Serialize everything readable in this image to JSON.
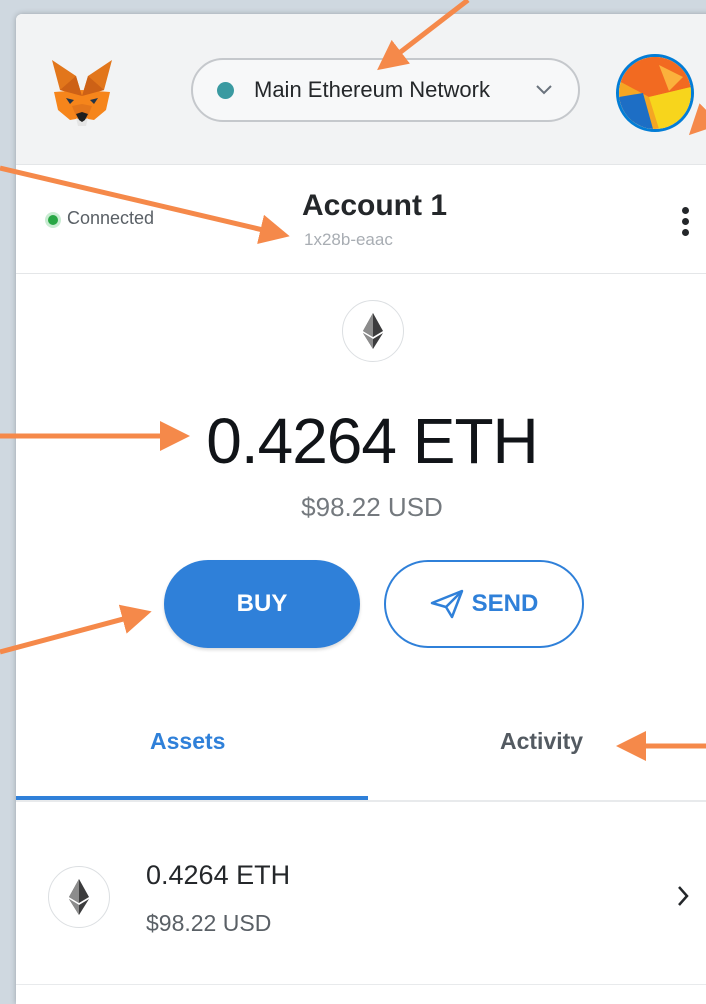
{
  "header": {
    "network_label": "Main Ethereum Network",
    "network_dot_color": "#3a9aa1"
  },
  "account": {
    "status": "Connected",
    "name": "Account 1",
    "address": "1x28b-eaac"
  },
  "balance": {
    "amount": "0.4264",
    "symbol": "ETH",
    "fiat": "$98.22 USD"
  },
  "actions": {
    "buy_label": "BUY",
    "send_label": "SEND"
  },
  "tabs": [
    {
      "label": "Assets",
      "active": true
    },
    {
      "label": "Activity",
      "active": false
    }
  ],
  "assets": [
    {
      "amount": "0.4264 ETH",
      "fiat": "$98.22 USD"
    }
  ],
  "colors": {
    "accent": "#2f80d9",
    "annotation_arrow": "#f5894a",
    "avatar_border": "#037dd6"
  },
  "icons": [
    "fox-logo-icon",
    "chevron-down-icon",
    "account-avatar-icon",
    "kebab-menu-icon",
    "eth-icon",
    "send-arrow-icon",
    "chevron-right-icon"
  ]
}
